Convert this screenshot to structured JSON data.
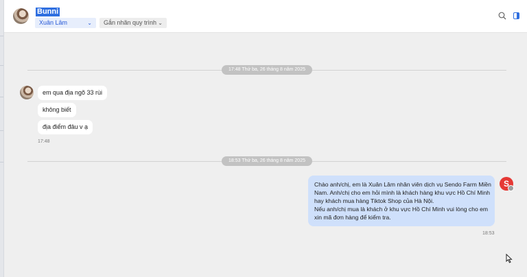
{
  "header": {
    "contact_name": "Bunni",
    "agent_select": {
      "value": "Xuân Lâm",
      "icon": "chevron-down"
    },
    "tag_select": {
      "value": "Gắn nhãn quy trình",
      "icon": "chevron-down"
    },
    "actions": [
      "search-icon",
      "side-panel-icon"
    ],
    "accent_color": "#2f6fe0"
  },
  "conversation": {
    "dividers": [
      {
        "label": "17:48 Thứ ba, 26 tháng 8 năm 2025"
      },
      {
        "label": "18:53 Thứ ba, 26 tháng 8 năm 2025"
      }
    ],
    "incoming": {
      "messages": [
        "em qua địa ngõ 33 rùi",
        "không biết",
        "địa điểm đâu v ạ"
      ],
      "time": "17:48",
      "bubble_color": "#ffffff"
    },
    "outgoing": {
      "lines": [
        "Chào anh/chị, em là Xuân Lâm nhân viên dịch vụ Sendo Farm Miền",
        "Nam. Anh/chị cho em hỏi mình là khách hàng khu vực Hồ Chí Minh",
        "hay khách mua hàng Tiktok Shop của Hà Nội.",
        "Nếu anh/chị mua là khách ở khu vực Hồ Chí Minh vui lòng cho em",
        "xin mã đơn hàng để kiểm tra."
      ],
      "time": "18:53",
      "bubble_color": "#cfe0fb",
      "avatar_color": "#e53935",
      "avatar_glyph": "S"
    }
  }
}
